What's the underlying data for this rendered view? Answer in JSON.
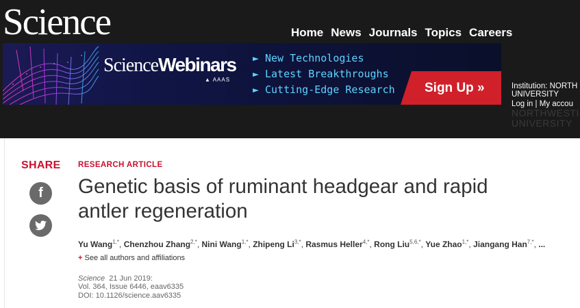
{
  "header": {
    "logo": "Science",
    "nav": [
      "Home",
      "News",
      "Journals",
      "Topics",
      "Careers"
    ]
  },
  "banner": {
    "brand_light": "Science",
    "brand_bold": "Webinars",
    "publisher": "AAAS",
    "bullets": [
      "New Technologies",
      "Latest Breakthroughs",
      "Cutting-Edge Research"
    ],
    "cta": "Sign Up »",
    "cta_color": "#d0202a",
    "bullet_color": "#5fd3ff"
  },
  "institution": {
    "line1": "Institution: NORTH",
    "line2": "UNIVERSITY",
    "login": "Log in",
    "separator": "|",
    "account": "My accou",
    "ghost1": "NORTHWESTI",
    "ghost2": "UNIVERSITY"
  },
  "share": {
    "label": "SHARE",
    "facebook_icon": "facebook-icon",
    "twitter_icon": "twitter-icon"
  },
  "article": {
    "type": "RESEARCH ARTICLE",
    "title_line1": "Genetic basis of ruminant headgear and rapid",
    "title_line2": "antler regeneration",
    "authors": [
      {
        "name": "Yu Wang",
        "sup": "1,*"
      },
      {
        "name": "Chenzhou Zhang",
        "sup": "2,*"
      },
      {
        "name": "Nini Wang",
        "sup": "1,*"
      },
      {
        "name": "Zhipeng Li",
        "sup": "3,*"
      },
      {
        "name": "Rasmus Heller",
        "sup": "4,*"
      },
      {
        "name": "Rong Liu",
        "sup": "5,6,*"
      },
      {
        "name": "Yue Zhao",
        "sup": "1,*"
      },
      {
        "name": "Jiangang Han",
        "sup": "7,*"
      }
    ],
    "authors_more": "...",
    "see_all_plus": "+",
    "see_all": "See all authors and affiliations",
    "journal": "Science",
    "date": "21 Jun 2019:",
    "volume": "Vol. 364, Issue 6446, eaav6335",
    "doi": "DOI: 10.1126/science.aav6335"
  },
  "colors": {
    "accent_red": "#c8102e",
    "header_bg": "#1a1a1a",
    "icon_gray": "#6a6a6a"
  }
}
